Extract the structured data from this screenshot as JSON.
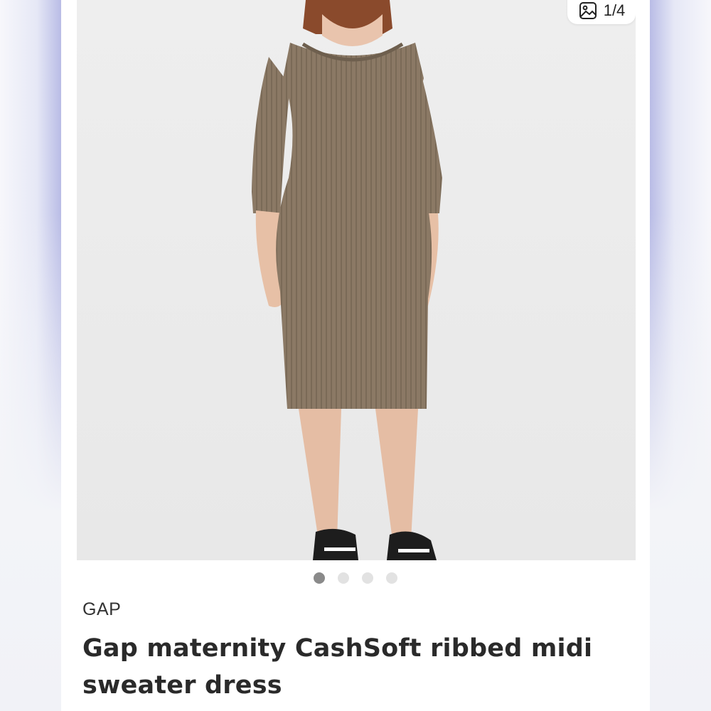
{
  "listing": {
    "brand": "GAP",
    "title": "Gap maternity CashSoft ribbed midi sweater dress"
  },
  "gallery": {
    "counter_text": "1/4",
    "counter_icon": "image-stack-icon",
    "current_index": 1,
    "total_images": 4
  },
  "colors": {
    "dress": "#8c7a66",
    "background": "#ececec",
    "accent_side": "#b9bce6"
  }
}
